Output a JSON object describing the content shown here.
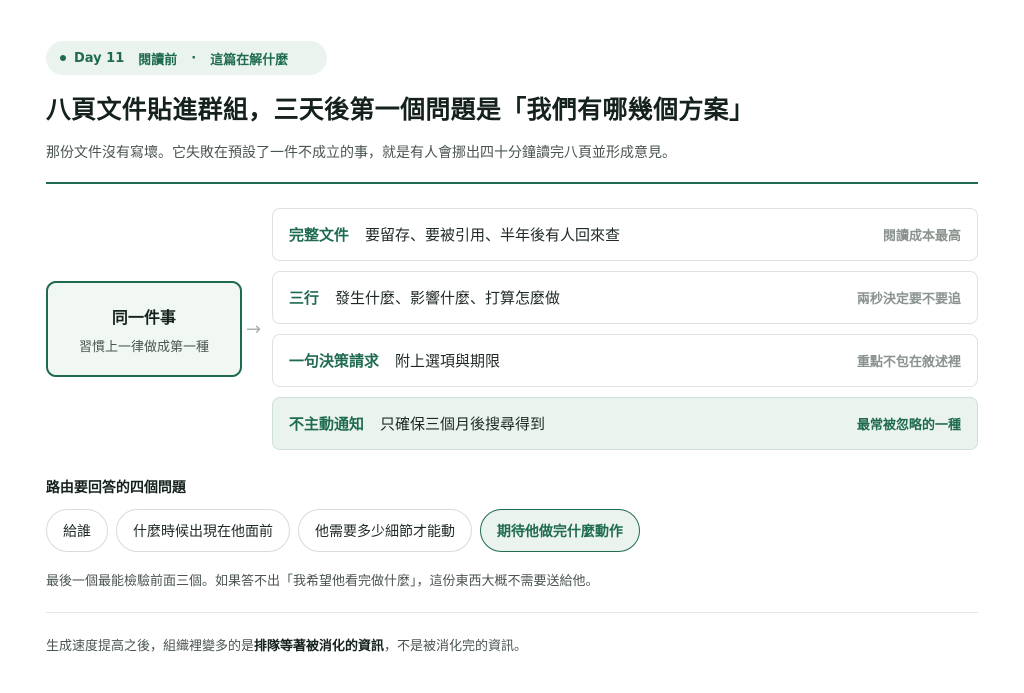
{
  "badge": {
    "day": "Day 11",
    "stage": "閱讀前",
    "separator": "·",
    "topic": "這篇在解什麼"
  },
  "title": "八頁文件貼進群組，三天後第一個問題是「我們有哪幾個方案」",
  "subtitle": "那份文件沒有寫壞。它失敗在預設了一件不成立的事，就是有人會挪出四十分鐘讀完八頁並形成意見。",
  "source": {
    "title": "同一件事",
    "subtitle": "習慣上一律做成第一種",
    "arrow": "→"
  },
  "options": [
    {
      "name": "完整文件",
      "desc": "要留存、要被引用、半年後有人回來查",
      "note": "閱讀成本最高"
    },
    {
      "name": "三行",
      "desc": "發生什麼、影響什麼、打算怎麼做",
      "note": "兩秒決定要不要追"
    },
    {
      "name": "一句決策請求",
      "desc": "附上選項與期限",
      "note": "重點不包在敘述裡"
    },
    {
      "name": "不主動通知",
      "desc": "只確保三個月後搜尋得到",
      "note": "最常被忽略的一種"
    }
  ],
  "questions": {
    "heading": "路由要回答的四個問題",
    "chips": [
      "給誰",
      "什麼時候出現在他面前",
      "他需要多少細節才能動",
      "期待他做完什麼動作"
    ],
    "note": "最後一個最能檢驗前面三個。如果答不出「我希望他看完做什麼」，這份東西大概不需要送給他。"
  },
  "footer": {
    "before": "生成速度提高之後，組織裡變多的是",
    "emphasis": "排隊等著被消化的資訊",
    "after": "，不是被消化完的資訊。"
  },
  "colors": {
    "accent": "#1f6b4f",
    "accent_soft": "#eaf3ee",
    "muted_text": "#4a5550",
    "note_text": "#8a938e"
  }
}
